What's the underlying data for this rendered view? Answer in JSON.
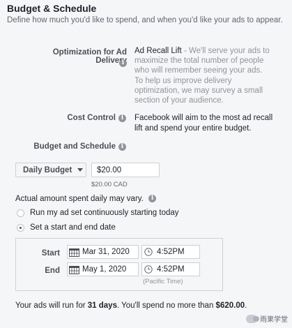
{
  "section": {
    "title": "Budget & Schedule",
    "description": "Define how much you'd like to spend, and when you'd like your ads to appear."
  },
  "optimization": {
    "label": "Optimization for Ad Delivery",
    "value_title": "Ad Recall Lift",
    "value_desc": " - We'll serve your ads to maximize the total number of people who will remember seeing your ads.",
    "note": "To help us improve delivery optimization, we may survey a small section of your audience."
  },
  "cost_control": {
    "label": "Cost Control",
    "text": "Facebook will aim to the most ad recall lift and spend your entire budget."
  },
  "budget_schedule": {
    "label": "Budget and Schedule",
    "budget_type": "Daily Budget",
    "amount": "$20.00",
    "amount_sub": "$20.00 CAD",
    "vary_text": "Actual amount spent daily may vary."
  },
  "schedule_options": [
    {
      "label": "Run my ad set continuously starting today",
      "selected": false
    },
    {
      "label": "Set a start and end date",
      "selected": true
    }
  ],
  "dates": {
    "start_label": "Start",
    "start_date": "Mar 31, 2020",
    "start_time": "4:52PM",
    "end_label": "End",
    "end_date": "May 1, 2020",
    "end_time": "4:52PM",
    "timezone": "(Pacific Time)"
  },
  "summary": {
    "prefix": "Your ads will run for ",
    "days": "31 days",
    "middle": ". You'll spend no more than ",
    "amount": "$620.00",
    "suffix": "."
  },
  "watermark": {
    "text": "雨果学堂"
  },
  "icons": {
    "info": "info-icon",
    "calendar": "calendar-icon",
    "clock": "clock-icon",
    "caret": "chevron-down-icon"
  }
}
